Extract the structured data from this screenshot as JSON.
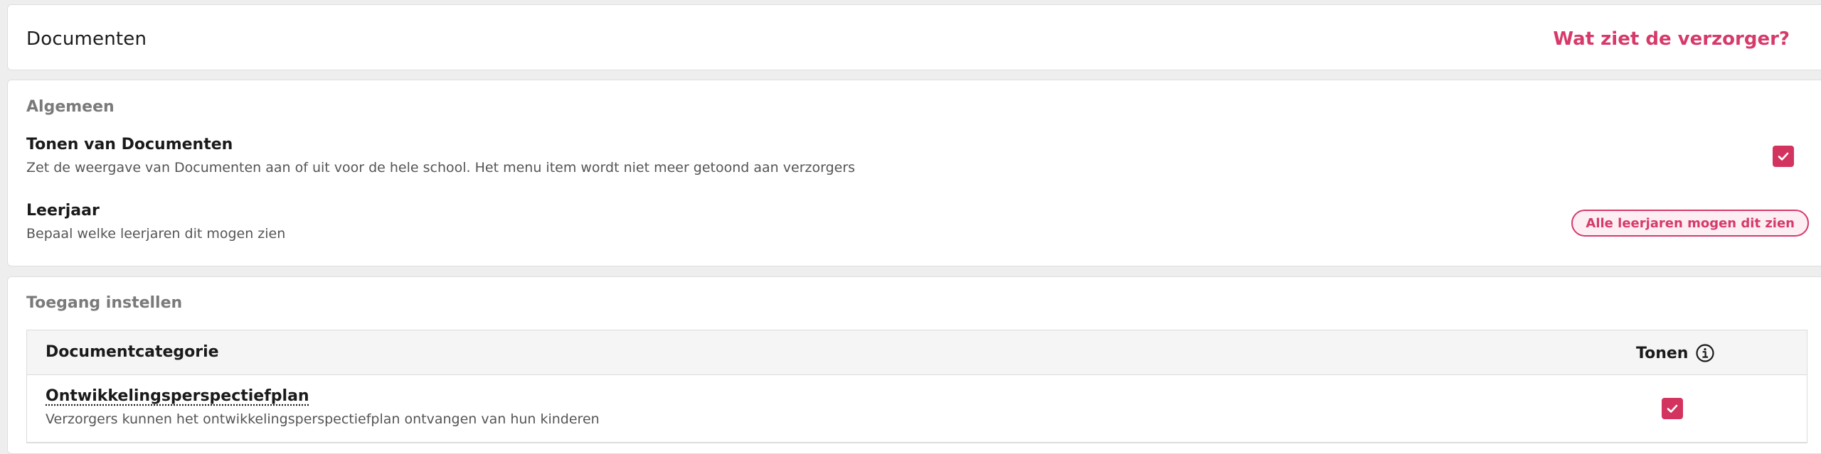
{
  "header": {
    "title": "Documenten",
    "guardian_link": "Wat ziet de verzorger?"
  },
  "general": {
    "section_title": "Algemeen",
    "show_documents": {
      "title": "Tonen van Documenten",
      "description": "Zet de weergave van Documenten aan of uit voor de hele school. Het menu item wordt niet meer getoond aan verzorgers",
      "checked": true
    },
    "school_year": {
      "title": "Leerjaar",
      "description": "Bepaal welke leerjaren dit mogen zien",
      "button_label": "Alle leerjaren mogen dit zien"
    }
  },
  "access": {
    "section_title": "Toegang instellen",
    "columns": {
      "category": "Documentcategorie",
      "show": "Tonen"
    },
    "rows": [
      {
        "title": "Ontwikkelingsperspectiefplan",
        "description": "Verzorgers kunnen het ontwikkelingsperspectiefplan ontvangen van hun kinderen",
        "checked": true
      }
    ]
  },
  "icons": {
    "checkmark": "check-icon",
    "info": "info-icon"
  },
  "colors": {
    "accent": "#d63a6a",
    "checkbox": "#d3335f",
    "background": "#eeeeef"
  }
}
